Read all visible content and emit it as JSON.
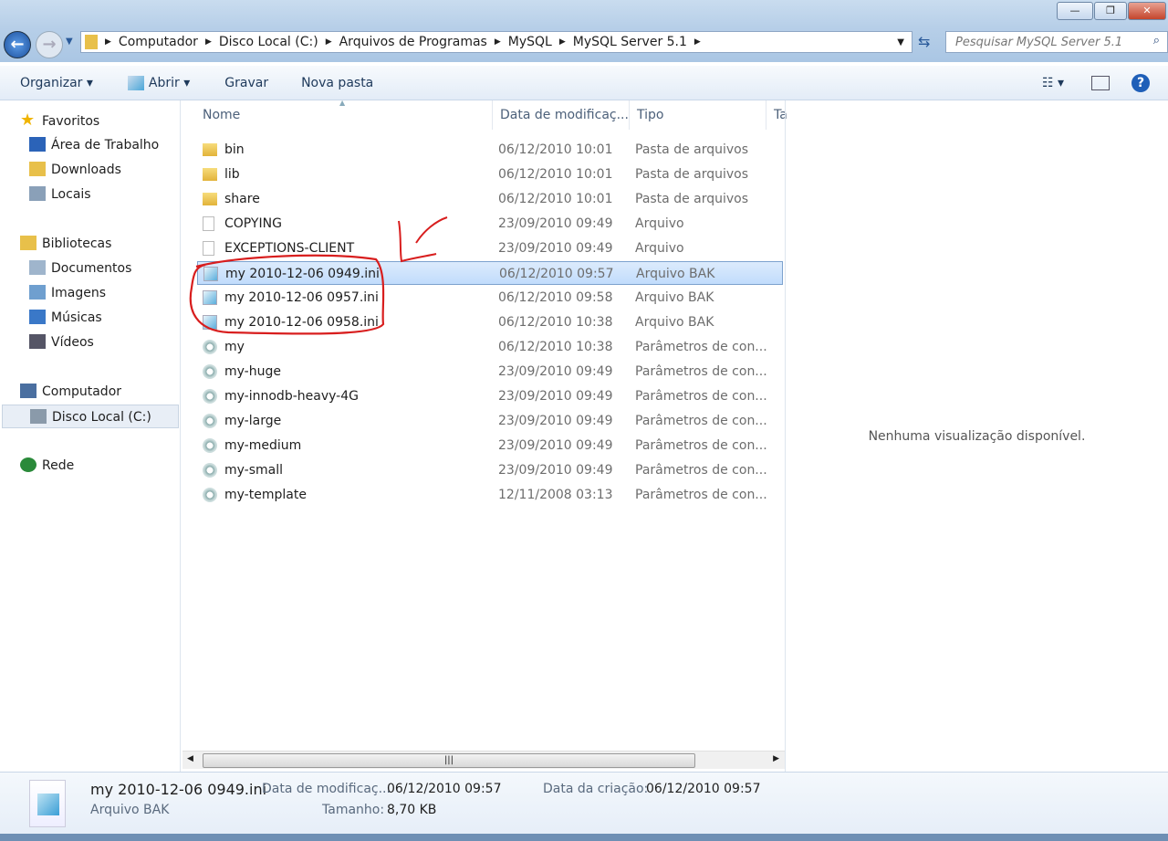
{
  "window": {
    "minimize": "—",
    "maximize": "❐",
    "close": "✕"
  },
  "address": {
    "crumbs": [
      "Computador",
      "Disco Local (C:)",
      "Arquivos de Programas",
      "MySQL",
      "MySQL Server 5.1"
    ],
    "search_placeholder": "Pesquisar MySQL Server 5.1"
  },
  "toolbar": {
    "organize": "Organizar ▾",
    "open": "Abrir ▾",
    "burn": "Gravar",
    "new_folder": "Nova pasta"
  },
  "sidebar": [
    {
      "label": "Favoritos",
      "icon": "star-icon",
      "color": "#f0b400"
    },
    {
      "label": "Área de Trabalho",
      "icon": "desktop-icon",
      "color": "#2b63b8"
    },
    {
      "label": "Downloads",
      "icon": "folder-icon",
      "color": "#e8c04a"
    },
    {
      "label": "Locais",
      "icon": "places-icon",
      "color": "#8aa0b8"
    },
    {
      "label": "Bibliotecas",
      "icon": "library-icon",
      "color": "#e8c04a"
    },
    {
      "label": "Documentos",
      "icon": "document-icon",
      "color": "#9fb5cc"
    },
    {
      "label": "Imagens",
      "icon": "image-icon",
      "color": "#6f9fcf"
    },
    {
      "label": "Músicas",
      "icon": "music-icon",
      "color": "#3a78c8"
    },
    {
      "label": "Vídeos",
      "icon": "video-icon",
      "color": "#556"
    },
    {
      "label": "Computador",
      "icon": "computer-icon",
      "color": "#4a6fa0"
    },
    {
      "label": "Disco Local (C:)",
      "icon": "drive-icon",
      "color": "#8a9aaa"
    },
    {
      "label": "Rede",
      "icon": "network-icon",
      "color": "#2a8a3a"
    }
  ],
  "columns": {
    "name": "Nome",
    "modified": "Data de modificaç...",
    "type": "Tipo",
    "size": "Ta"
  },
  "files": [
    {
      "name": "bin",
      "modified": "06/12/2010 10:01",
      "type": "Pasta de arquivos",
      "icon": "folder"
    },
    {
      "name": "lib",
      "modified": "06/12/2010 10:01",
      "type": "Pasta de arquivos",
      "icon": "folder"
    },
    {
      "name": "share",
      "modified": "06/12/2010 10:01",
      "type": "Pasta de arquivos",
      "icon": "folder"
    },
    {
      "name": "COPYING",
      "modified": "23/09/2010 09:49",
      "type": "Arquivo",
      "icon": "file"
    },
    {
      "name": "EXCEPTIONS-CLIENT",
      "modified": "23/09/2010 09:49",
      "type": "Arquivo",
      "icon": "file"
    },
    {
      "name": "my 2010-12-06 0949.ini",
      "modified": "06/12/2010 09:57",
      "type": "Arquivo BAK",
      "icon": "bak",
      "selected": true
    },
    {
      "name": "my 2010-12-06 0957.ini",
      "modified": "06/12/2010 09:58",
      "type": "Arquivo BAK",
      "icon": "bak"
    },
    {
      "name": "my 2010-12-06 0958.ini",
      "modified": "06/12/2010 10:38",
      "type": "Arquivo BAK",
      "icon": "bak"
    },
    {
      "name": "my",
      "modified": "06/12/2010 10:38",
      "type": "Parâmetros de con...",
      "icon": "config"
    },
    {
      "name": "my-huge",
      "modified": "23/09/2010 09:49",
      "type": "Parâmetros de con...",
      "icon": "config"
    },
    {
      "name": "my-innodb-heavy-4G",
      "modified": "23/09/2010 09:49",
      "type": "Parâmetros de con...",
      "icon": "config"
    },
    {
      "name": "my-large",
      "modified": "23/09/2010 09:49",
      "type": "Parâmetros de con...",
      "icon": "config"
    },
    {
      "name": "my-medium",
      "modified": "23/09/2010 09:49",
      "type": "Parâmetros de con...",
      "icon": "config"
    },
    {
      "name": "my-small",
      "modified": "23/09/2010 09:49",
      "type": "Parâmetros de con...",
      "icon": "config"
    },
    {
      "name": "my-template",
      "modified": "12/11/2008 03:13",
      "type": "Parâmetros de con...",
      "icon": "config"
    }
  ],
  "preview": {
    "text": "Nenhuma visualização disponível."
  },
  "details": {
    "name": "my 2010-12-06 0949.ini",
    "type": "Arquivo BAK",
    "modified_label": "Data de modificaç...",
    "modified": "06/12/2010 09:57",
    "created_label": "Data da criação:",
    "created": "06/12/2010 09:57",
    "size_label": "Tamanho:",
    "size": "8,70 KB"
  },
  "colors": {
    "annotation": "#d81e1e",
    "selection": "#c1dcfc"
  }
}
